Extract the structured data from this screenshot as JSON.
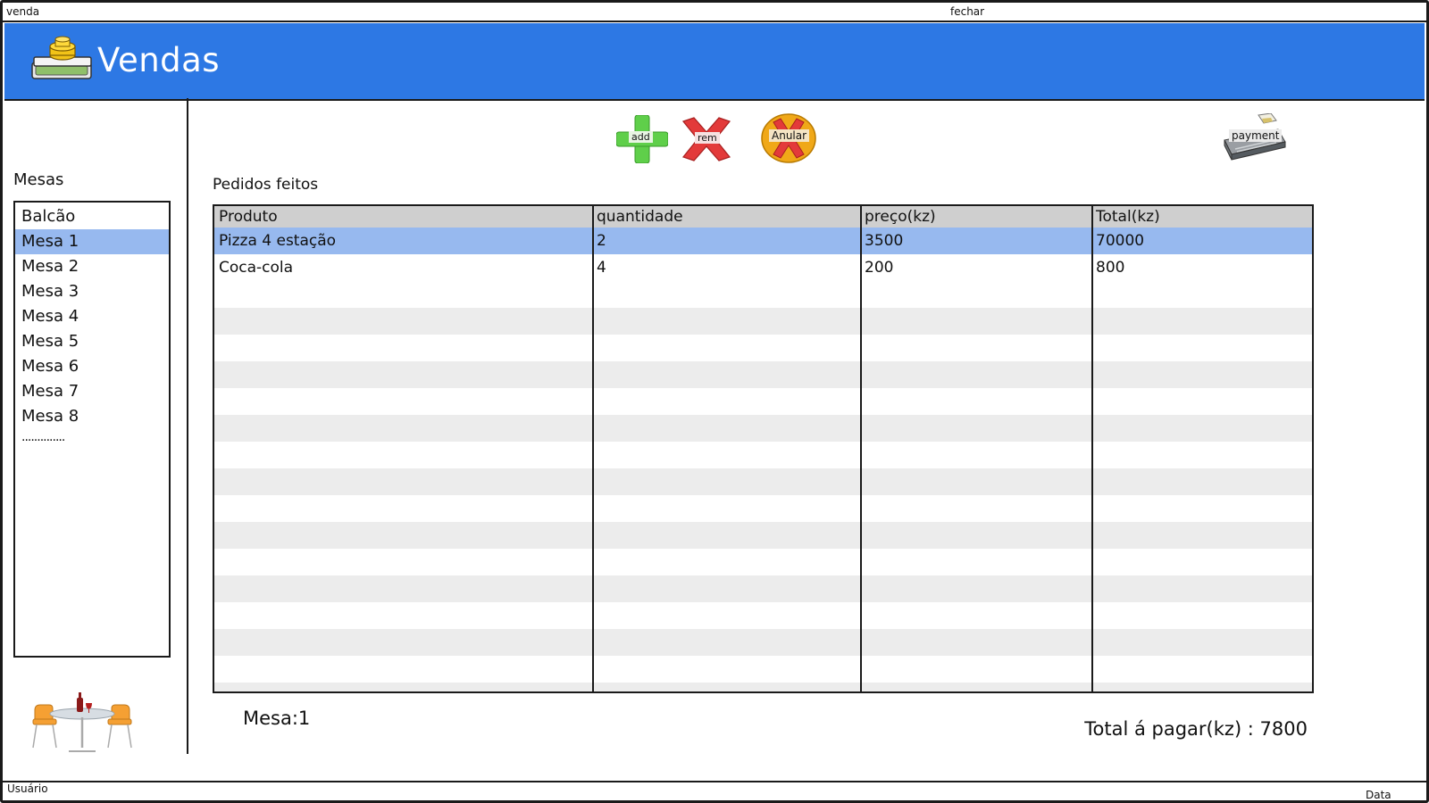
{
  "window": {
    "title": "venda",
    "close_label": "fechar"
  },
  "header": {
    "title": "Vendas",
    "background_color": "#2d78e4"
  },
  "sidebar": {
    "label": "Mesas",
    "items": [
      {
        "label": "Balcão",
        "selected": false
      },
      {
        "label": "Mesa 1",
        "selected": true
      },
      {
        "label": "Mesa 2",
        "selected": false
      },
      {
        "label": "Mesa 3",
        "selected": false
      },
      {
        "label": "Mesa 4",
        "selected": false
      },
      {
        "label": "Mesa 5",
        "selected": false
      },
      {
        "label": "Mesa 6",
        "selected": false
      },
      {
        "label": "Mesa 7",
        "selected": false
      },
      {
        "label": "Mesa 8",
        "selected": false
      }
    ],
    "more": "..............",
    "illustration_icon": "restaurant-table-icon"
  },
  "toolbar": {
    "add_label": "add",
    "remove_label": "rem",
    "void_label": "Anular",
    "payment_label": "payment"
  },
  "orders": {
    "label": "Pedidos feitos",
    "columns": [
      "Produto",
      "quantidade",
      "preço(kz)",
      "Total(kz)"
    ],
    "rows": [
      {
        "cells": [
          "Pizza 4 estação",
          "2",
          "3500",
          "70000"
        ],
        "selected": true
      },
      {
        "cells": [
          "Coca-cola",
          "4",
          "200",
          "800"
        ],
        "selected": false
      }
    ],
    "selected_color": "#97b9ef"
  },
  "footer": {
    "mesa": "Mesa:1",
    "total": "Total á pagar(kz) : 7800"
  },
  "statusbar": {
    "user_label": "Usuário",
    "date_label": "Data"
  }
}
